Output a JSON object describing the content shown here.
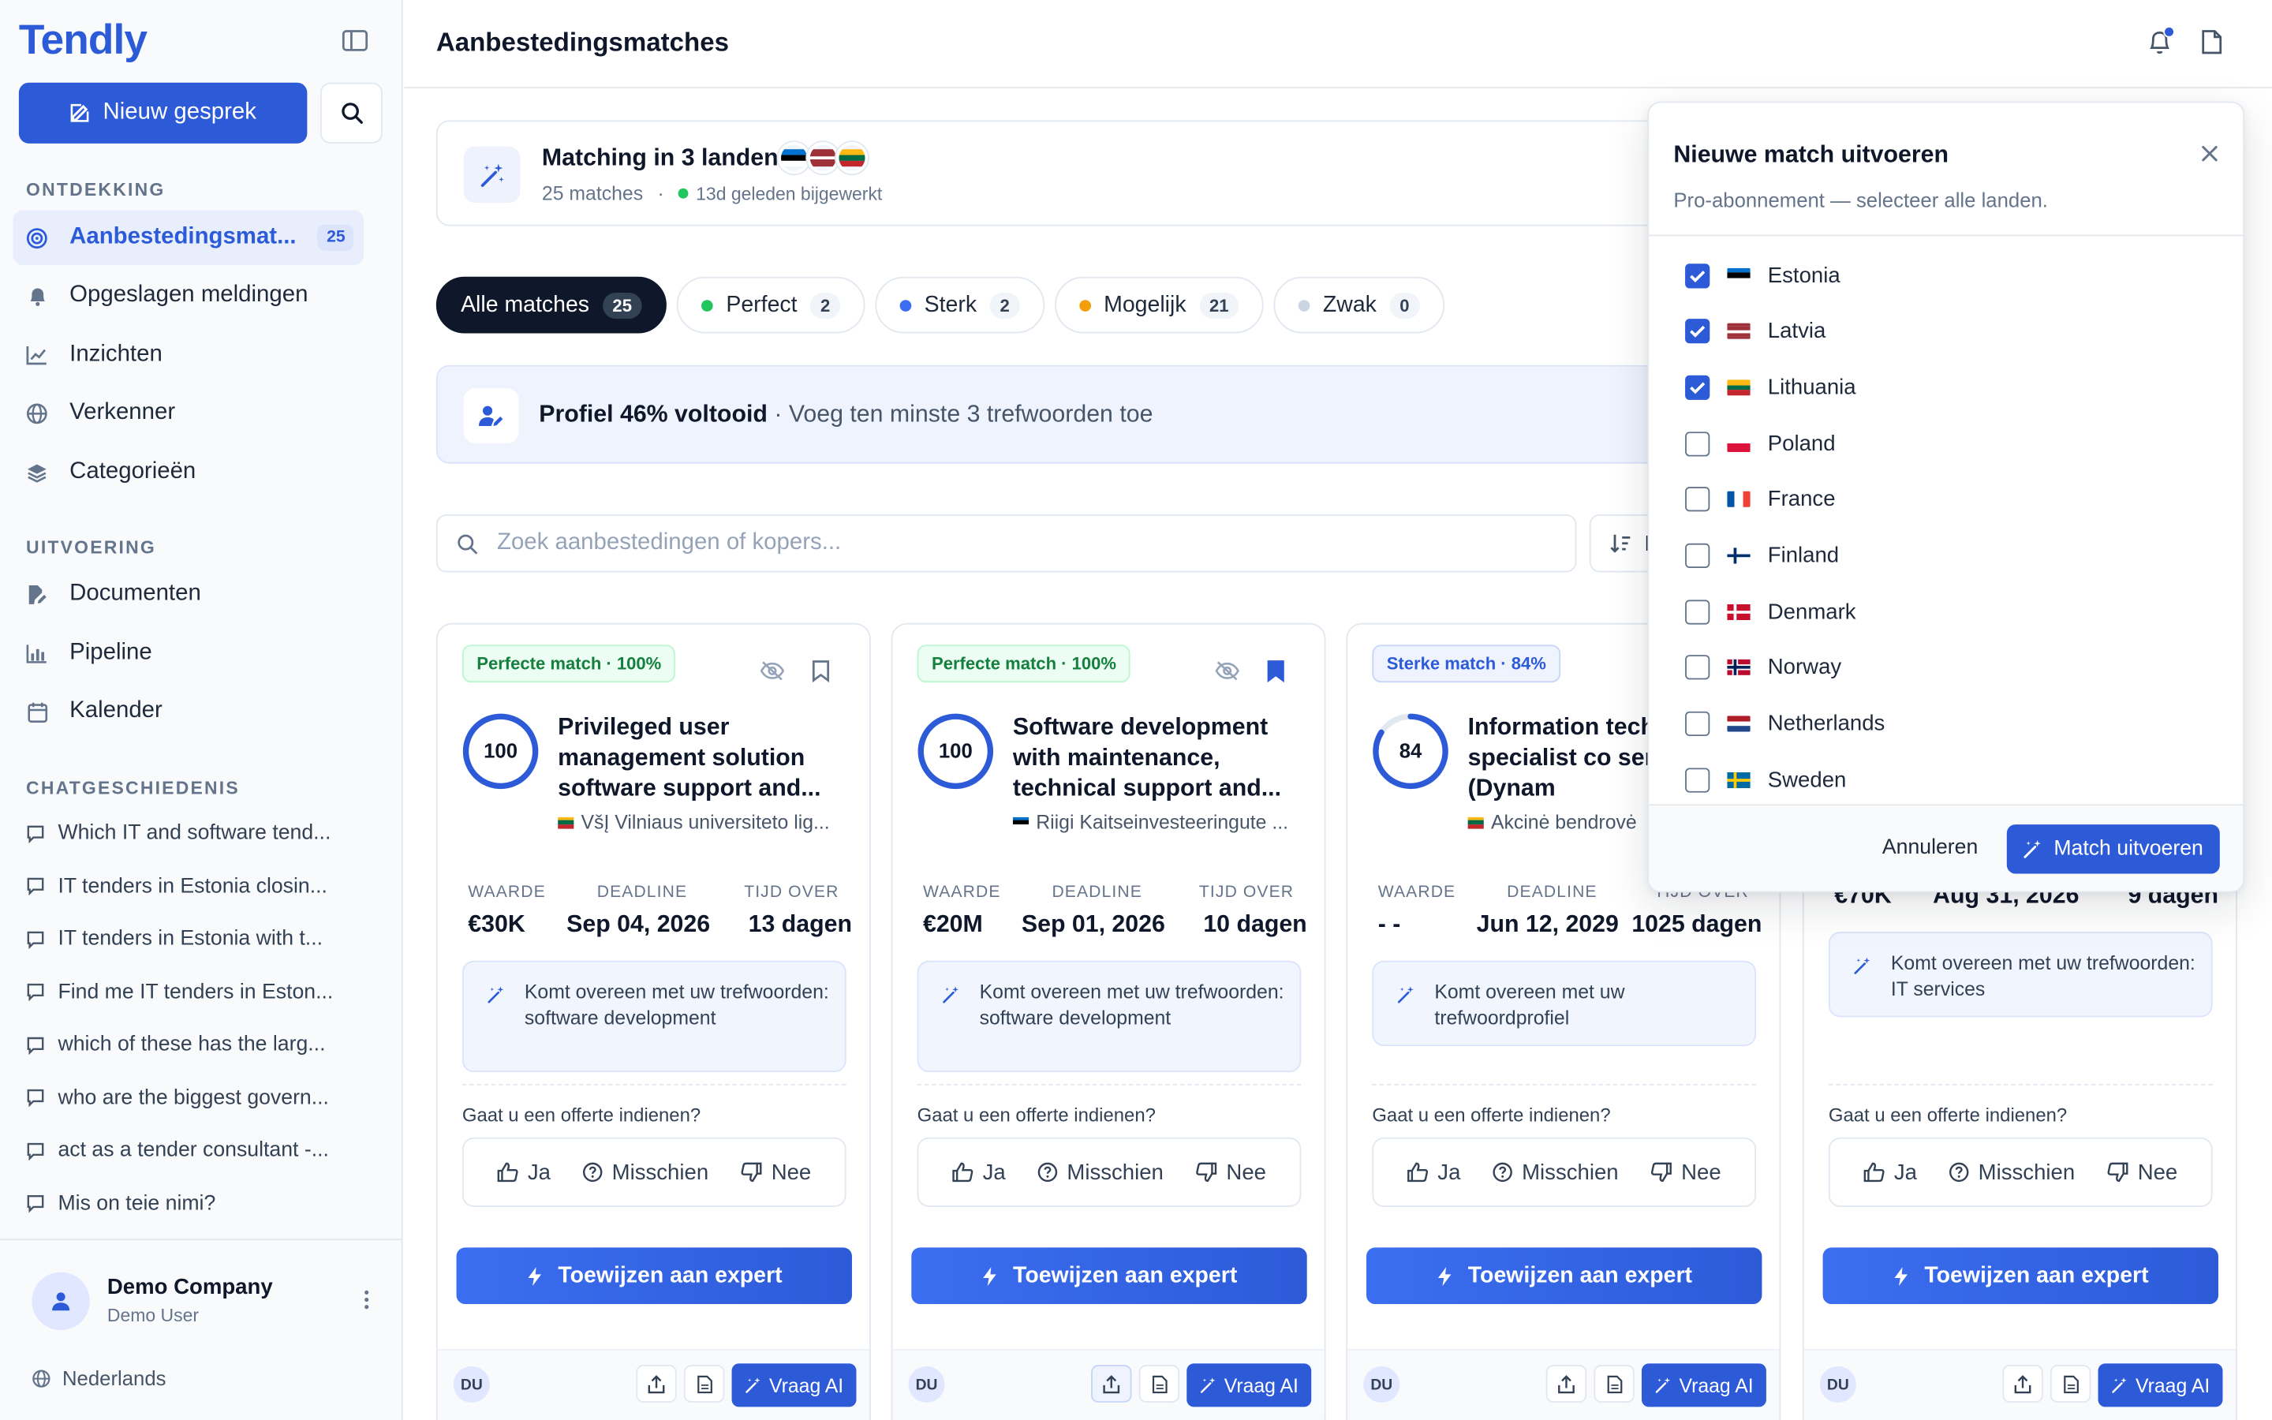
{
  "app": {
    "name": "Tendly",
    "page_title": "Aanbestedingsmatches"
  },
  "sidebar": {
    "new_chat_label": "Nieuw gesprek",
    "sections": {
      "discovery": "ONTDEKKING",
      "execution": "UITVOERING",
      "chat_history": "CHATGESCHIEDENIS"
    },
    "discovery_items": [
      {
        "label": "Aanbestedingsmat...",
        "badge": "25",
        "icon": "target-icon",
        "active": true
      },
      {
        "label": "Opgeslagen meldingen",
        "icon": "bell-icon"
      },
      {
        "label": "Inzichten",
        "icon": "chart-line-icon"
      },
      {
        "label": "Verkenner",
        "icon": "globe-icon"
      },
      {
        "label": "Categorieën",
        "icon": "layers-icon"
      }
    ],
    "execution_items": [
      {
        "label": "Documenten",
        "icon": "document-edit-icon"
      },
      {
        "label": "Pipeline",
        "icon": "bar-chart-icon"
      },
      {
        "label": "Kalender",
        "icon": "calendar-icon"
      }
    ],
    "chats": [
      "Which IT and software tend...",
      "IT tenders in Estonia closin...",
      "IT tenders in Estonia with t...",
      "Find me IT tenders in Eston...",
      "which of these has the larg...",
      "who are the biggest govern...",
      "act as a tender consultant -...",
      "Mis on teie nimi?"
    ],
    "footer": {
      "company": "Demo Company",
      "user": "Demo User",
      "language": "Nederlands"
    }
  },
  "matching": {
    "title": "Matching in 3 landen",
    "count": "25 matches",
    "separator": "·",
    "updated": "13d geleden bijgewerkt"
  },
  "filters": [
    {
      "label": "Alle matches",
      "count": "25",
      "active": true
    },
    {
      "label": "Perfect",
      "count": "2",
      "color": "#22c55e"
    },
    {
      "label": "Sterk",
      "count": "2",
      "color": "#3b6ef0"
    },
    {
      "label": "Mogelijk",
      "count": "21",
      "color": "#f59e0b"
    },
    {
      "label": "Zwak",
      "count": "0",
      "color": "#cbd5e1"
    }
  ],
  "profile": {
    "strong": "Profiel 46% voltooid",
    "muted": " · Voeg ten minste 3 trefwoorden toe"
  },
  "search": {
    "placeholder": "Zoek aanbestedingen of kopers...",
    "sort_label": "L"
  },
  "labels": {
    "value": "WAARDE",
    "deadline": "DEADLINE",
    "time_left": "TIJD OVER",
    "question": "Gaat u een offerte indienen?",
    "yes": "Ja",
    "maybe": "Misschien",
    "no": "Nee",
    "assign": "Toewijzen aan expert",
    "ask_ai": "Vraag AI",
    "avatar": "DU"
  },
  "cards": [
    {
      "tag": "Perfecte match · 100%",
      "score": 100,
      "title": "Privileged user management solution software support and...",
      "buyer": "VšĮ Vilniaus universiteto lig...",
      "value": "€30K",
      "deadline": "Sep 04, 2026",
      "time_left": "13 dagen",
      "keywords": "Komt overeen met uw trefwoorden: software development",
      "bookmarked": false
    },
    {
      "tag": "Perfecte match · 100%",
      "score": 100,
      "title": "Software development with maintenance, technical support and...",
      "buyer": "Riigi Kaitseinvesteeringute ...",
      "value": "€20M",
      "deadline": "Sep 01, 2026",
      "time_left": "10 dagen",
      "keywords": "Komt overeen met uw trefwoorden: software development",
      "bookmarked": true
    },
    {
      "tag": "Sterke match · 84%",
      "score": 84,
      "title": "Information tech (IT) specialist co services (Dynam",
      "buyer": "Akcinė bendrovė",
      "value": "- -",
      "deadline": "Jun 12, 2029",
      "time_left": "1025 dagen",
      "keywords": "Komt overeen met uw trefwoordprofiel",
      "bookmarked": false
    },
    {
      "value": "€70K",
      "deadline": "Aug 31, 2026",
      "time_left": "9 dagen",
      "keywords": "Komt overeen met uw trefwoorden: IT services"
    }
  ],
  "panel": {
    "title": "Nieuwe match uitvoeren",
    "subtitle": "Pro-abonnement — selecteer alle landen.",
    "countries": [
      {
        "name": "Estonia",
        "checked": true
      },
      {
        "name": "Latvia",
        "checked": true
      },
      {
        "name": "Lithuania",
        "checked": true
      },
      {
        "name": "Poland",
        "checked": false
      },
      {
        "name": "France",
        "checked": false
      },
      {
        "name": "Finland",
        "checked": false
      },
      {
        "name": "Denmark",
        "checked": false
      },
      {
        "name": "Norway",
        "checked": false
      },
      {
        "name": "Netherlands",
        "checked": false
      },
      {
        "name": "Sweden",
        "checked": false
      }
    ],
    "cancel_label": "Annuleren",
    "run_label": "Match uitvoeren"
  },
  "colors": {
    "brand": "#2d5bd8",
    "dark": "#0f172a",
    "success": "#22c55e"
  }
}
